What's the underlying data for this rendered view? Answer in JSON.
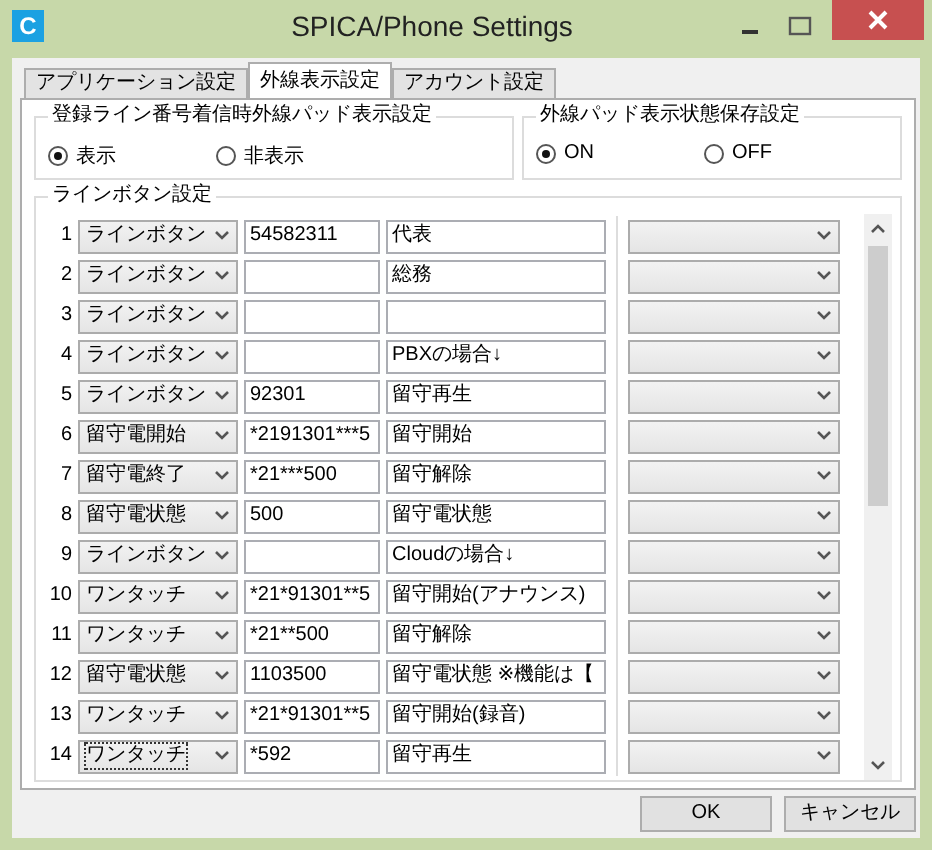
{
  "window": {
    "icon_letter": "C",
    "title": "SPICA/Phone Settings"
  },
  "tabs": [
    {
      "label": "アプリケーション設定",
      "selected": false
    },
    {
      "label": "外線表示設定",
      "selected": true
    },
    {
      "label": "アカウント設定",
      "selected": false
    }
  ],
  "groups": [
    {
      "title": "登録ライン番号着信時外線パッド表示設定",
      "options": [
        {
          "label": "表示",
          "selected": true
        },
        {
          "label": "非表示",
          "selected": false
        }
      ]
    },
    {
      "title": "外線パッド表示状態保存設定",
      "options": [
        {
          "label": "ON",
          "selected": true
        },
        {
          "label": "OFF",
          "selected": false
        }
      ]
    }
  ],
  "line_buttons": {
    "title": "ラインボタン設定",
    "rows": [
      {
        "index": "1",
        "type": "ラインボタン",
        "number": "54582311",
        "label": "代表",
        "focused": false
      },
      {
        "index": "2",
        "type": "ラインボタン",
        "number": "",
        "label": "総務",
        "focused": false
      },
      {
        "index": "3",
        "type": "ラインボタン",
        "number": "",
        "label": "",
        "focused": false
      },
      {
        "index": "4",
        "type": "ラインボタン",
        "number": "",
        "label": "PBXの場合↓",
        "focused": false
      },
      {
        "index": "5",
        "type": "ラインボタン",
        "number": "92301",
        "label": "留守再生",
        "focused": false
      },
      {
        "index": "6",
        "type": "留守電開始",
        "number": "*2191301***5",
        "label": "留守開始",
        "focused": false
      },
      {
        "index": "7",
        "type": "留守電終了",
        "number": "*21***500",
        "label": "留守解除",
        "focused": false
      },
      {
        "index": "8",
        "type": "留守電状態",
        "number": "500",
        "label": "留守電状態",
        "focused": false
      },
      {
        "index": "9",
        "type": "ラインボタン",
        "number": "",
        "label": "Cloudの場合↓",
        "focused": false
      },
      {
        "index": "10",
        "type": "ワンタッチ",
        "number": "*21*91301**5",
        "label": "留守開始(アナウンス)",
        "focused": false
      },
      {
        "index": "11",
        "type": "ワンタッチ",
        "number": "*21**500",
        "label": "留守解除",
        "focused": false
      },
      {
        "index": "12",
        "type": "留守電状態",
        "number": "1103500",
        "label": "留守電状態 ※機能は【",
        "focused": false
      },
      {
        "index": "13",
        "type": "ワンタッチ",
        "number": "*21*91301**5",
        "label": "留守開始(録音)",
        "focused": false
      },
      {
        "index": "14",
        "type": "ワンタッチ",
        "number": "*592",
        "label": "留守再生",
        "focused": true
      }
    ]
  },
  "buttons": [
    "OK",
    "キャンセル"
  ]
}
